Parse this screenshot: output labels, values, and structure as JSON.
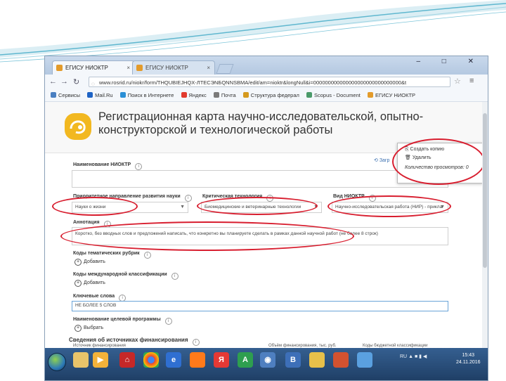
{
  "browser": {
    "tabs": [
      {
        "label": "ЕГИСУ НИОКТР",
        "close": "×"
      },
      {
        "label": "ЕГИСУ НИОКТР",
        "close": "×"
      }
    ],
    "window_controls": "– □ ✕",
    "url": "www.rosrid.ru/niokr/form/THQUBIEJHQX-ЛТЕСЭNБQNNSBMA/edit/am=nioktr&longNull&i=000000000000000000000000000000&t",
    "bookmarks": [
      {
        "label": "Сервисы",
        "color": "#4a7fc1"
      },
      {
        "label": "Mail.Ru",
        "color": "#1e63c5"
      },
      {
        "label": "Поиск в Интернете",
        "color": "#2a8fd6"
      },
      {
        "label": "Яндекс",
        "color": "#e23a2e"
      },
      {
        "label": "Почта",
        "color": "#7a7a7a"
      },
      {
        "label": "Структура федерал",
        "color": "#d59a1f"
      },
      {
        "label": "Scopus - Document",
        "color": "#4a9a6a"
      },
      {
        "label": "ЕГИСУ НИОКТР",
        "color": "#e39b2b"
      }
    ]
  },
  "page": {
    "title": "Регистрационная карта научно-исследовательской, опытно-конструкторской и технологической работы",
    "save_hint": "Загр",
    "popup": {
      "item1": "Создать копию",
      "item2": "Удалить",
      "item3": "Количество просмотров: 0"
    },
    "fields": {
      "name_label": "Наименование НИОКТР",
      "direction_label": "Приоритетное направление развития науки",
      "direction_value": "Науки о жизни",
      "technology_label": "Критическая технология",
      "technology_value": "Биомедицинские и ветеринарные технологии",
      "type_label": "Вид НИОКТР",
      "type_value": "Научно-исследовательская работа (НИР) - прикла",
      "annotation_label": "Аннотация",
      "annotation_value": "Коротко, без вводных слов и предложений написать, что конкретно вы планируете сделать в рамках данной научной работ (не более 8 строк)",
      "rubric_label": "Коды тематических рубрик",
      "rubric_add": "Добавить",
      "intl_label": "Коды международной классификации",
      "intl_add": "Добавить",
      "keywords_label": "Ключевые слова",
      "keywords_value": "НЕ БОЛЕЕ 5 СЛОВ",
      "program_label": "Наименование целевой программы",
      "program_add": "Выбрать",
      "funding_label": "Сведения об источниках финансирования",
      "col1": "Источник финансирования",
      "col2": "Объём финансирования, тыс. руб.",
      "col3": "Коды бюджетной классификации"
    }
  },
  "taskbar": {
    "apps": [
      "Я",
      "A",
      "B"
    ],
    "lang": "RU",
    "time": "15:43",
    "date": "24.11.2016"
  },
  "colors": {
    "highlight": "#d81e2f",
    "logo": "#f2b820",
    "taskbar": "#1f3f66"
  }
}
